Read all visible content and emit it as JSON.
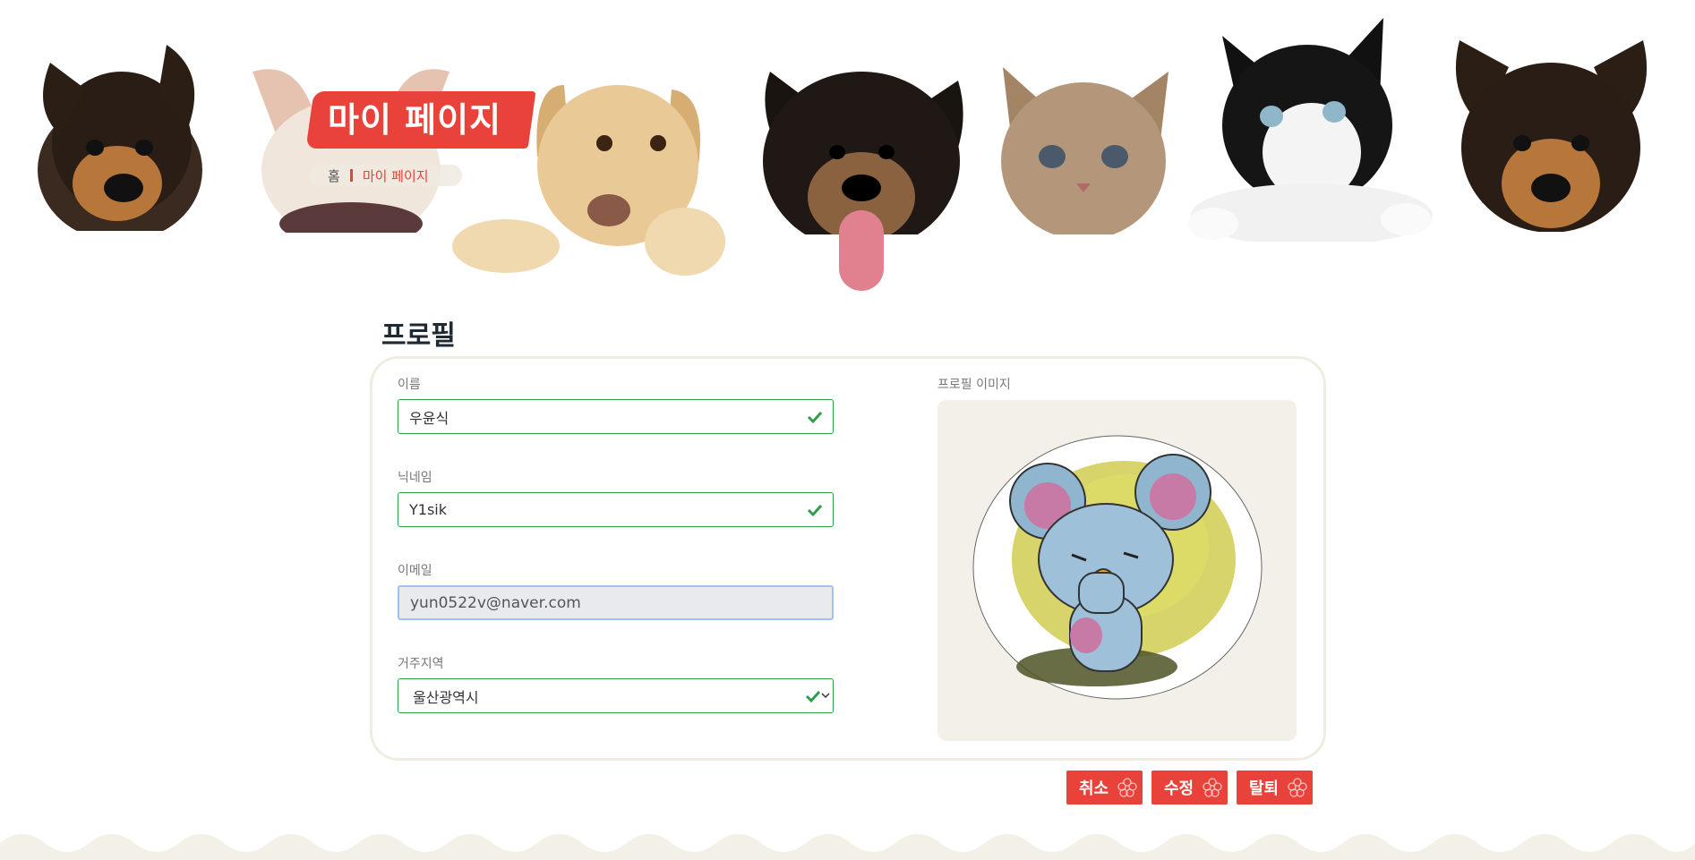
{
  "header": {
    "title": "마이 페이지",
    "breadcrumb": {
      "home": "홈",
      "current": "마이 페이지"
    }
  },
  "profile": {
    "section_title": "프로필",
    "fields": {
      "name": {
        "label": "이름",
        "value": "우윤식"
      },
      "nickname": {
        "label": "닉네임",
        "value": "Y1sik"
      },
      "email": {
        "label": "이메일",
        "value": "yun0522v@naver.com"
      },
      "region": {
        "label": "거주지역",
        "value": "울산광역시"
      }
    },
    "image_label": "프로필 이미지"
  },
  "actions": {
    "cancel": "취소",
    "edit": "수정",
    "withdraw": "탈퇴"
  },
  "colors": {
    "accent": "#e8423a",
    "valid": "#2f9e4a",
    "panel": "#f3f0e9"
  },
  "icons": {
    "valid": "check-icon",
    "select": "chevron-down-icon",
    "button": "flower-icon"
  }
}
